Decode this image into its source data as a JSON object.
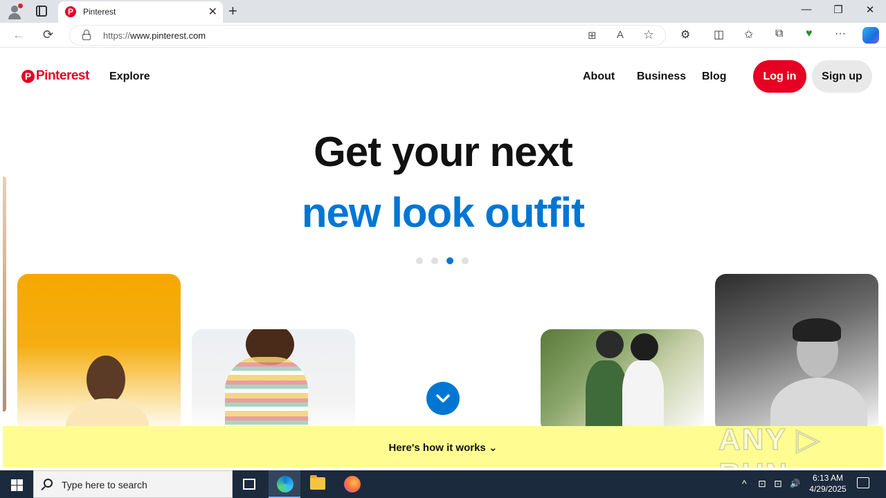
{
  "browser": {
    "tab": {
      "title": "Pinterest",
      "favicon": "P",
      "close": "✕"
    },
    "new_tab": "+",
    "window_controls": {
      "minimize": "—",
      "restore": "❐",
      "close": "✕"
    },
    "address": {
      "scheme": "https://",
      "host": "www.pinterest.com"
    },
    "icons": {
      "back": "←",
      "refresh": "⟳",
      "apps": "⊞",
      "read_aloud": "A",
      "favorite": "☆",
      "extensions": "⚙",
      "split": "◫",
      "favorites": "✩",
      "collections": "⧉",
      "performance": "♥",
      "more": "···"
    }
  },
  "site": {
    "logo": {
      "mark": "P",
      "word": "Pinterest"
    },
    "explore": "Explore",
    "nav": {
      "about": "About",
      "business": "Business",
      "blog": "Blog"
    },
    "login": "Log in",
    "signup": "Sign up",
    "headline_line1": "Get your next",
    "headline_line2": "new look outfit",
    "carousel": {
      "total": 4,
      "active_index": 2
    },
    "how_it_works": "Here's how it works",
    "how_chevron": "⌄",
    "watermark": "ANY ▷ RUN"
  },
  "colors": {
    "brand_red": "#e60023",
    "accent_blue": "#0076d3",
    "how_bar": "#fffd92"
  },
  "taskbar": {
    "search_placeholder": "Type here to search",
    "tray": {
      "chevron": "^",
      "network": "⊡",
      "volume": "🔊"
    },
    "time": "6:13 AM",
    "date": "4/29/2025"
  }
}
